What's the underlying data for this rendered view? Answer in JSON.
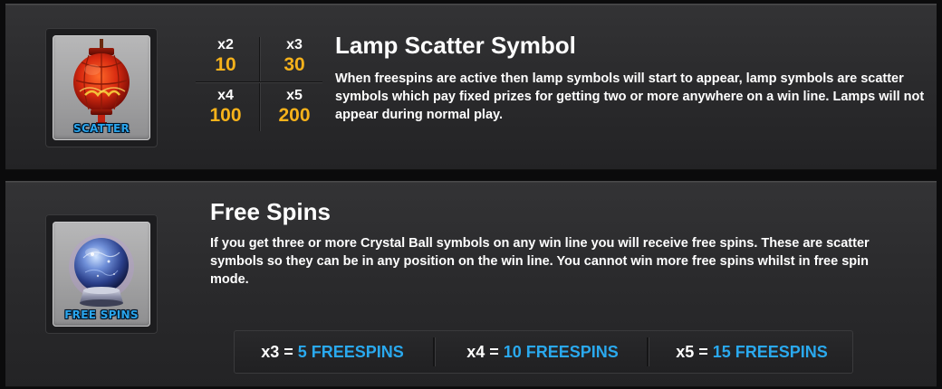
{
  "lamp_section": {
    "title": "Lamp Scatter Symbol",
    "description": "When freespins are active then lamp symbols will start to appear, lamp symbols are scatter symbols which pay fixed prizes for getting two or more anywhere on a win line. Lamps will not appear during normal play.",
    "symbol_icon": "red-lantern-icon",
    "symbol_caption": "SCATTER",
    "paytable": [
      {
        "multiplier": "x2",
        "value": "10"
      },
      {
        "multiplier": "x3",
        "value": "30"
      },
      {
        "multiplier": "x4",
        "value": "100"
      },
      {
        "multiplier": "x5",
        "value": "200"
      }
    ]
  },
  "free_spins_section": {
    "title": "Free Spins",
    "description": "If you get three or more Crystal Ball symbols on any win line you will receive free spins. These are scatter symbols so they can be in any position on the win line. You cannot win more free spins whilst in free spin mode.",
    "symbol_icon": "crystal-ball-icon",
    "symbol_caption": "FREE SPINS",
    "awards": [
      {
        "multiplier": "x3",
        "equals": "=",
        "value": "5 FREESPINS"
      },
      {
        "multiplier": "x4",
        "equals": "=",
        "value": "10 FREESPINS"
      },
      {
        "multiplier": "x5",
        "equals": "=",
        "value": "15 FREESPINS"
      }
    ]
  },
  "colors": {
    "prize_value": "#f6b21b",
    "freespins_value": "#2aa9ee",
    "caption": "#2aa6ee"
  }
}
